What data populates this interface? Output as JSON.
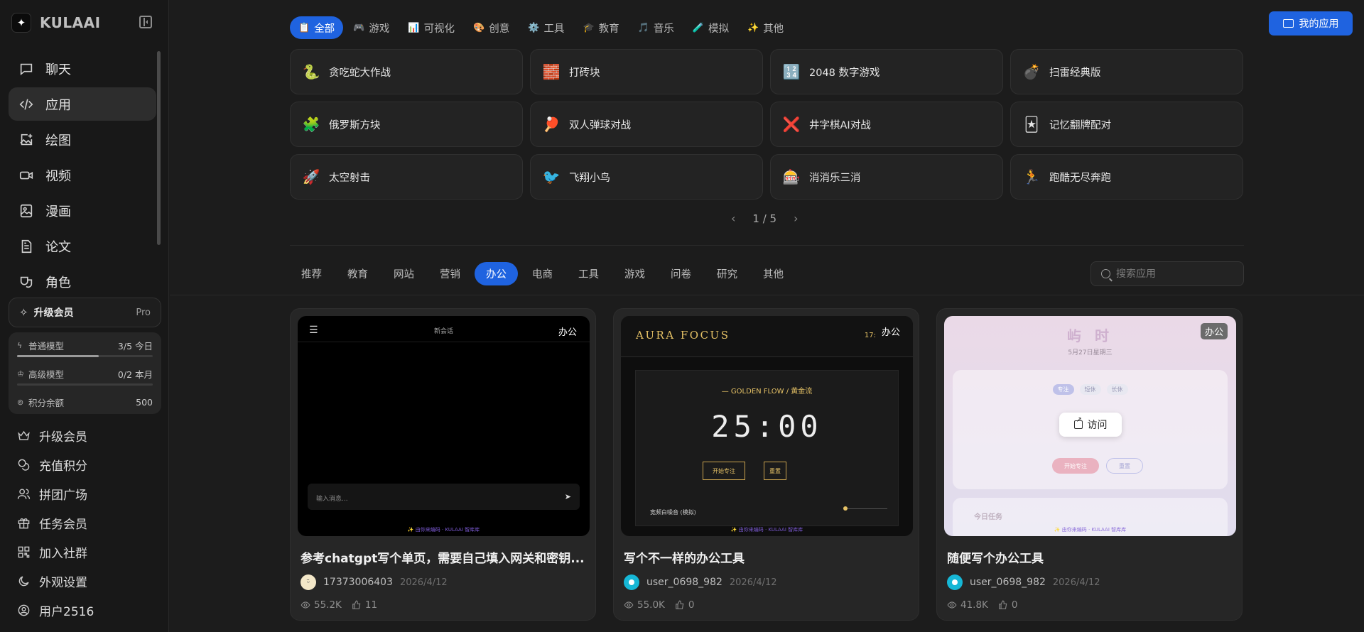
{
  "brand": {
    "name": "KULAAI",
    "logo_glyph": "✦"
  },
  "sidebar": {
    "nav": [
      {
        "label": "聊天",
        "icon": "chat-icon"
      },
      {
        "label": "应用",
        "icon": "code-icon",
        "active": true
      },
      {
        "label": "绘图",
        "icon": "image-plus-icon"
      },
      {
        "label": "视频",
        "icon": "video-icon"
      },
      {
        "label": "漫画",
        "icon": "comic-icon"
      },
      {
        "label": "论文",
        "icon": "document-icon"
      },
      {
        "label": "角色",
        "icon": "drama-icon"
      }
    ],
    "upgrade": {
      "label": "升级会员",
      "tier": "Pro"
    },
    "quota": [
      {
        "label": "普通模型",
        "value": "3/5 今日",
        "icon": "bolt-icon",
        "progress": 0.6
      },
      {
        "label": "高级模型",
        "value": "0/2 本月",
        "icon": "crown-icon",
        "progress": 0
      },
      {
        "label": "积分余额",
        "value": "500",
        "icon": "coin-icon"
      }
    ],
    "menu": [
      {
        "label": "升级会员",
        "icon": "crown-icon"
      },
      {
        "label": "充值积分",
        "icon": "coins-icon"
      },
      {
        "label": "拼团广场",
        "icon": "users-icon"
      },
      {
        "label": "任务会员",
        "icon": "gift-icon"
      },
      {
        "label": "加入社群",
        "icon": "qr-icon"
      },
      {
        "label": "外观设置",
        "icon": "moon-icon"
      },
      {
        "label": "用户2516",
        "icon": "user-circle-icon"
      }
    ]
  },
  "header": {
    "my_apps_label": "我的应用"
  },
  "category_tabs": [
    {
      "label": "全部",
      "emoji": "📋",
      "active": true
    },
    {
      "label": "游戏",
      "emoji": "🎮"
    },
    {
      "label": "可视化",
      "emoji": "📊"
    },
    {
      "label": "创意",
      "emoji": "🎨"
    },
    {
      "label": "工具",
      "emoji": "⚙️"
    },
    {
      "label": "教育",
      "emoji": "🎓"
    },
    {
      "label": "音乐",
      "emoji": "🎵"
    },
    {
      "label": "模拟",
      "emoji": "🧪"
    },
    {
      "label": "其他",
      "emoji": "✨"
    }
  ],
  "games": [
    {
      "label": "贪吃蛇大作战",
      "emoji": "🐍"
    },
    {
      "label": "打砖块",
      "emoji": "🧱"
    },
    {
      "label": "2048 数字游戏",
      "emoji": "🔢"
    },
    {
      "label": "扫雷经典版",
      "emoji": "💣"
    },
    {
      "label": "俄罗斯方块",
      "emoji": "🧩"
    },
    {
      "label": "双人弹球对战",
      "emoji": "🏓"
    },
    {
      "label": "井字棋AI对战",
      "emoji": "❌"
    },
    {
      "label": "记忆翻牌配对",
      "emoji": "🃏"
    },
    {
      "label": "太空射击",
      "emoji": "🚀"
    },
    {
      "label": "飞翔小鸟",
      "emoji": "🐦"
    },
    {
      "label": "消消乐三消",
      "emoji": "🎰"
    },
    {
      "label": "跑酷无尽奔跑",
      "emoji": "🏃"
    }
  ],
  "pager": {
    "prev": "‹",
    "label": "1 / 5",
    "next": "›"
  },
  "filter_tabs": [
    {
      "label": "推荐"
    },
    {
      "label": "教育"
    },
    {
      "label": "网站"
    },
    {
      "label": "营销"
    },
    {
      "label": "办公",
      "active": true
    },
    {
      "label": "电商"
    },
    {
      "label": "工具"
    },
    {
      "label": "游戏"
    },
    {
      "label": "问卷"
    },
    {
      "label": "研究"
    },
    {
      "label": "其他"
    }
  ],
  "search": {
    "placeholder": "搜索应用"
  },
  "cards": [
    {
      "title": "参考chatgpt写个单页，需要自己填入网关和密钥...",
      "author": "17373006403",
      "date": "2026/4/12",
      "views": "55.2K",
      "likes": "11",
      "badge": "办公",
      "avatar": "cream",
      "preview": {
        "header": "新会话",
        "input_placeholder": "输入消息...",
        "footer": "✨ 由你来编码 · KULAAI 智库库"
      }
    },
    {
      "title": "写个不一样的办公工具",
      "author": "user_0698_982",
      "date": "2026/4/12",
      "views": "55.0K",
      "likes": "0",
      "badge": "办公",
      "avatar": "cyan",
      "preview": {
        "brand": "AURA FOCUS",
        "clock": "17:",
        "label": "— GOLDEN FLOW / 黄金流",
        "time": "25:00",
        "start": "开始专注",
        "reset": "重置",
        "noise": "宽频白噪音 (模拟)",
        "footer": "✨ 由你来编码 · KULAAI 智库库"
      }
    },
    {
      "title": "随便写个办公工具",
      "author": "user_0698_982",
      "date": "2026/4/12",
      "views": "41.8K",
      "likes": "0",
      "badge": "办公",
      "avatar": "cyan",
      "visit_label": "访问",
      "preview": {
        "title": "屿 时",
        "date": "5月27日星期三",
        "chips": [
          "专注",
          "短休",
          "长休"
        ],
        "start": "开始专注",
        "reset": "重置",
        "task": "今日任务",
        "footer": "✨ 由你来编码 · KULAAI 智库库"
      }
    }
  ]
}
